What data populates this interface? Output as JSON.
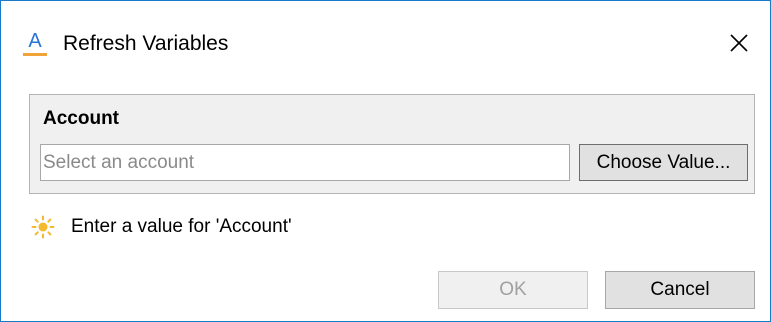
{
  "window": {
    "app_icon_letter": "A",
    "title": "Refresh Variables",
    "close_icon": "close-icon"
  },
  "group": {
    "label": "Account",
    "input_value": "",
    "input_placeholder": "Select an account",
    "choose_button_label": "Choose Value..."
  },
  "hint": {
    "icon": "sun-icon",
    "text": "Enter a value for 'Account'"
  },
  "buttons": {
    "ok_label": "OK",
    "ok_enabled": false,
    "cancel_label": "Cancel"
  },
  "colors": {
    "window_border": "#1979ca",
    "app_icon_letter": "#2a74d6",
    "app_icon_underline": "#f0a43a",
    "hint_icon": "#f5b82e",
    "group_background": "#f0f0f0",
    "disabled_text": "#a0a0a0"
  }
}
